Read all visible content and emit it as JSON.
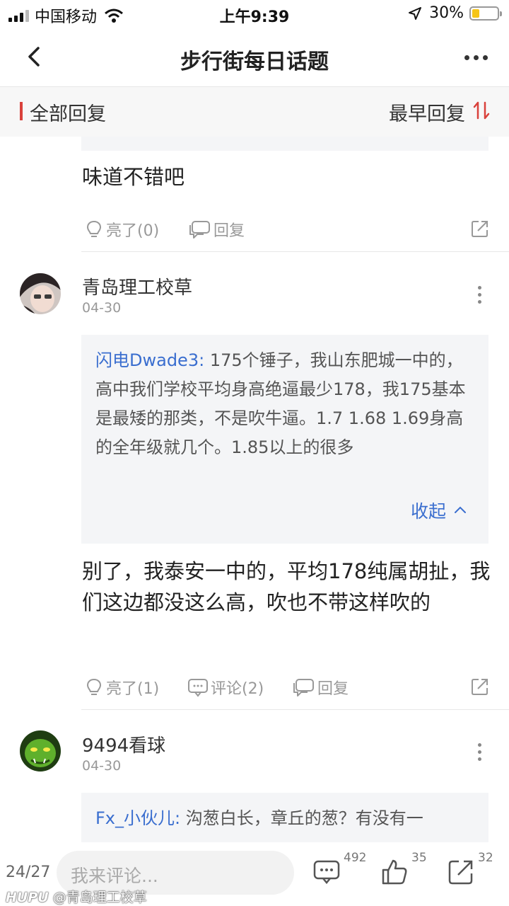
{
  "status_bar": {
    "carrier": "中国移动",
    "time": "上午9:39",
    "battery": "30%",
    "battery_level": 0.3
  },
  "nav": {
    "title": "步行街每日话题"
  },
  "sort_bar": {
    "all_replies": "全部回复",
    "order": "最早回复"
  },
  "first_reply": {
    "text": "味道不错吧",
    "light": "亮了(0)",
    "reply": "回复"
  },
  "post1": {
    "username": "青岛理工校草",
    "date": "04-30",
    "quote_author": "闪电Dwade3:",
    "quote_text": "175个锤子，我山东肥城一中的，高中我们学校平均身高绝逼最少178，我175基本是最矮的那类，不是吹牛逼。1.7 1.68  1.69身高的全年级就几个。1.85以上的很多",
    "collapse": "收起",
    "text": "别了，我泰安一中的，平均178纯属胡扯，我们这边都没这么高，吹也不带这样吹的",
    "light": "亮了(1)",
    "comment": "评论(2)",
    "reply": "回复"
  },
  "post2": {
    "username": "9494看球",
    "date": "04-30",
    "quote_author": "Fx_小伙儿:",
    "quote_text": "沟葱白长，章丘的葱？有没有一"
  },
  "bottom_bar": {
    "page": "24/27",
    "input_placeholder": "我来评论...",
    "comments_count": "492",
    "likes_count": "35",
    "share_count": "32"
  },
  "watermark": {
    "brand": "HUPU",
    "user": "@青岛理工校草"
  },
  "colors": {
    "accent_blue": "#3a6ecf",
    "accent_red": "#d9413b"
  }
}
